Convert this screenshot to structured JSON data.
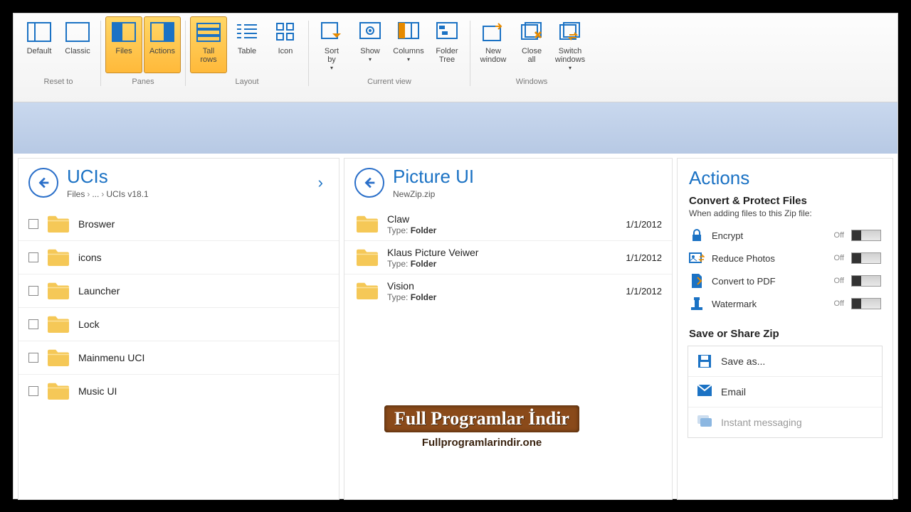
{
  "ribbon": {
    "groups": [
      {
        "label": "Reset to",
        "buttons": [
          {
            "name": "default",
            "label": "Default"
          },
          {
            "name": "classic",
            "label": "Classic"
          }
        ]
      },
      {
        "label": "Panes",
        "buttons": [
          {
            "name": "files",
            "label": "Files",
            "active": true
          },
          {
            "name": "actions",
            "label": "Actions",
            "active": true
          }
        ]
      },
      {
        "label": "Layout",
        "buttons": [
          {
            "name": "tall-rows",
            "label": "Tall\nrows",
            "active": true
          },
          {
            "name": "table",
            "label": "Table"
          },
          {
            "name": "icon",
            "label": "Icon"
          }
        ]
      },
      {
        "label": "Current view",
        "buttons": [
          {
            "name": "sort-by",
            "label": "Sort\nby",
            "dd": true
          },
          {
            "name": "show",
            "label": "Show",
            "dd": true
          },
          {
            "name": "columns",
            "label": "Columns",
            "dd": true
          },
          {
            "name": "folder-tree",
            "label": "Folder\nTree"
          }
        ]
      },
      {
        "label": "Windows",
        "buttons": [
          {
            "name": "new-window",
            "label": "New\nwindow"
          },
          {
            "name": "close-all",
            "label": "Close\nall"
          },
          {
            "name": "switch-windows",
            "label": "Switch\nwindows",
            "dd": true
          }
        ]
      }
    ]
  },
  "leftPane": {
    "title": "UCIs",
    "path": [
      "Files",
      "...",
      "UCIs v18.1"
    ],
    "items": [
      {
        "name": "Broswer"
      },
      {
        "name": "icons"
      },
      {
        "name": "Launcher"
      },
      {
        "name": "Lock"
      },
      {
        "name": "Mainmenu UCI"
      },
      {
        "name": "Music UI"
      }
    ]
  },
  "midPane": {
    "title": "Picture UI",
    "path": "NewZip.zip",
    "typeLabel": "Type:",
    "typeValue": "Folder",
    "items": [
      {
        "name": "Claw",
        "date": "1/1/2012"
      },
      {
        "name": "Klaus Picture Veiwer",
        "date": "1/1/2012"
      },
      {
        "name": "Vision",
        "date": "1/1/2012"
      }
    ]
  },
  "actions": {
    "title": "Actions",
    "convert": {
      "heading": "Convert & Protect Files",
      "desc": "When adding files to this Zip file:"
    },
    "toggles": [
      {
        "name": "encrypt",
        "label": "Encrypt",
        "state": "Off"
      },
      {
        "name": "reduce-photos",
        "label": "Reduce Photos",
        "state": "Off"
      },
      {
        "name": "convert-pdf",
        "label": "Convert to PDF",
        "state": "Off"
      },
      {
        "name": "watermark",
        "label": "Watermark",
        "state": "Off"
      }
    ],
    "share": {
      "heading": "Save or Share Zip",
      "items": [
        {
          "name": "save-as",
          "label": "Save as..."
        },
        {
          "name": "email",
          "label": "Email"
        },
        {
          "name": "instant-messaging",
          "label": "Instant messaging"
        }
      ]
    }
  },
  "watermark": {
    "line1": "Full Programlar İndir",
    "line2": "Fullprogramlarindir.one"
  }
}
